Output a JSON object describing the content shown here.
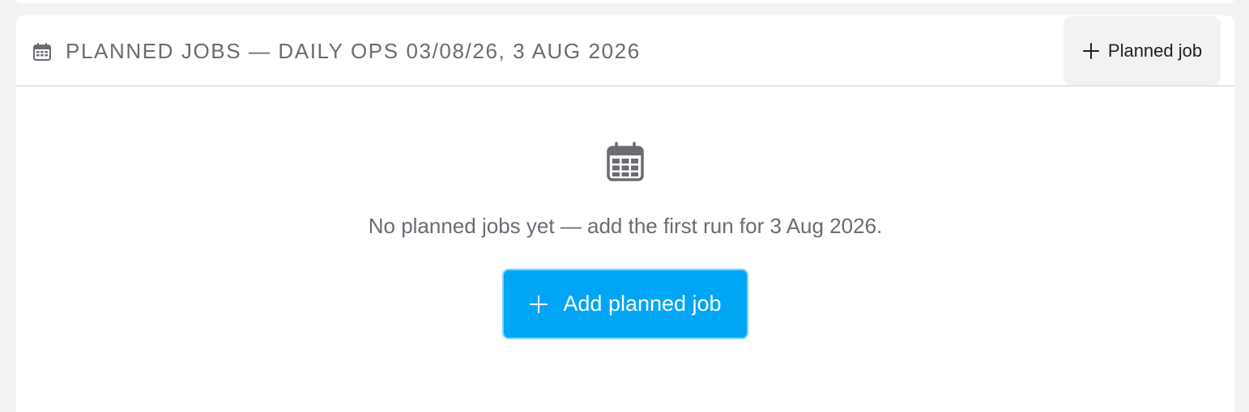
{
  "panel": {
    "title": "PLANNED JOBS — DAILY OPS 03/08/26, 3 AUG 2026",
    "title_icon": "calendar-icon",
    "header_button_label": "Planned job",
    "header_button_icon": "plus-icon"
  },
  "empty_state": {
    "icon": "calendar-icon",
    "message": "No planned jobs yet — add the first run for 3 Aug 2026.",
    "button_label": "Add planned job",
    "button_icon": "plus-icon"
  },
  "colors": {
    "accent": "#00a6f4",
    "muted_text": "#6b6b74",
    "background": "#f3f3f4"
  }
}
